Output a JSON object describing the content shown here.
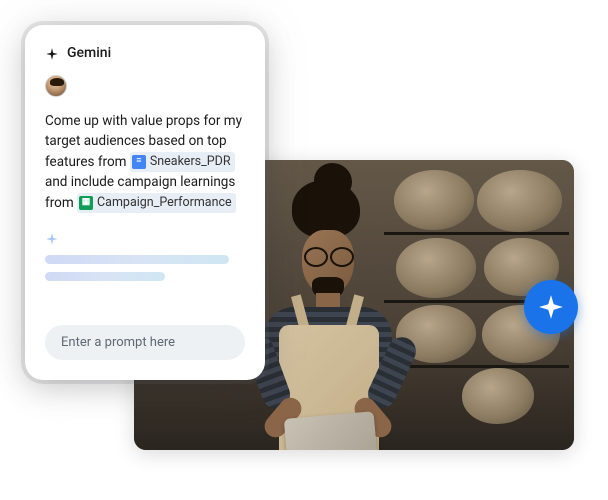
{
  "gemini": {
    "title": "Gemini",
    "prompt": {
      "part1": "Come up with value props for my target audiences based on top features from ",
      "file1": "Sneakers_PDR",
      "part2": " and include campaign learnings from ",
      "file2": "Campaign_Performance"
    },
    "input_placeholder": "Enter a prompt here"
  }
}
